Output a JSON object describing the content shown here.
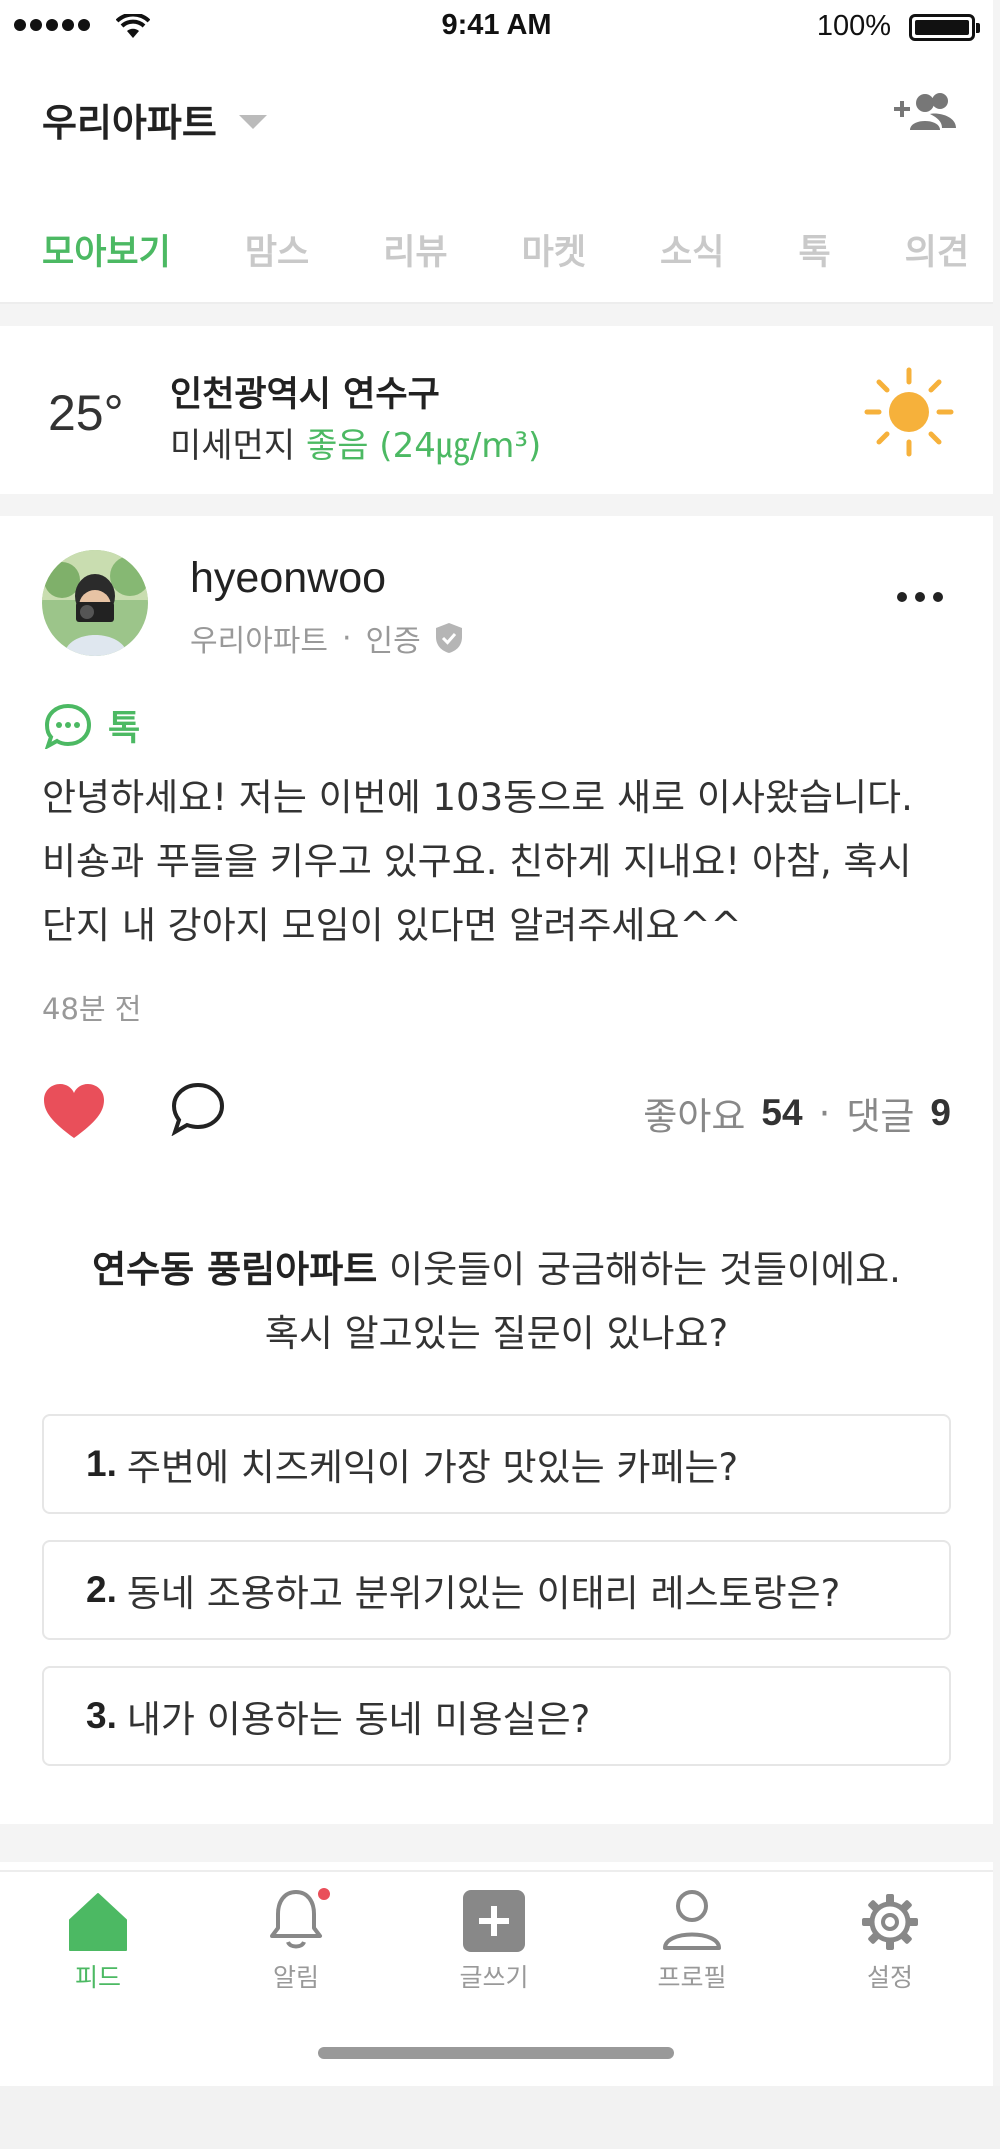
{
  "status_bar": {
    "time": "9:41 AM",
    "battery_percent": "100%"
  },
  "header": {
    "apartment_name": "우리아파트"
  },
  "tabs": [
    {
      "label": "모아보기",
      "active": true
    },
    {
      "label": "맘스",
      "active": false
    },
    {
      "label": "리뷰",
      "active": false
    },
    {
      "label": "마켓",
      "active": false
    },
    {
      "label": "소식",
      "active": false
    },
    {
      "label": "톡",
      "active": false
    },
    {
      "label": "의견",
      "active": false
    }
  ],
  "weather": {
    "temperature": "25°",
    "location": "인천광역시 연수구",
    "dust_label": "미세먼지",
    "dust_status": "좋음 (24㎍/m³)",
    "icon": "sun-icon"
  },
  "post": {
    "username": "hyeonwoo",
    "apartment": "우리아파트",
    "separator": "·",
    "verified_label": "인증",
    "category": "톡",
    "body": "안녕하세요! 저는 이번에 103동으로 새로 이사왔습니다. 비숑과 푸들을 키우고 있구요. 친하게 지내요! 아참, 혹시 단지 내 강아지 모임이 있다면 알려주세요^^",
    "time_ago": "48분 전",
    "likes_label": "좋아요",
    "likes_count": "54",
    "comments_label": "댓글",
    "comments_count": "9"
  },
  "questions": {
    "apartment_bold": "연수동 풍림아파트",
    "intro_rest": " 이웃들이 궁금해하는 것들이에요.",
    "intro_line2": "혹시 알고있는 질문이 있나요?",
    "items": [
      {
        "num": "1.",
        "text": "주변에 치즈케익이 가장 맛있는 카페는?"
      },
      {
        "num": "2.",
        "text": "동네 조용하고 분위기있는 이태리 레스토랑은?"
      },
      {
        "num": "3.",
        "text": "내가 이용하는 동네 미용실은?"
      }
    ]
  },
  "nav": [
    {
      "label": "피드",
      "icon": "home-icon",
      "active": true
    },
    {
      "label": "알림",
      "icon": "bell-icon",
      "active": false
    },
    {
      "label": "글쓰기",
      "icon": "write-icon",
      "active": false
    },
    {
      "label": "프로필",
      "icon": "profile-icon",
      "active": false
    },
    {
      "label": "설정",
      "icon": "gear-icon",
      "active": false
    }
  ],
  "colors": {
    "accent": "#4cb963",
    "like": "#e94f5a",
    "sun": "#f6b13b"
  }
}
